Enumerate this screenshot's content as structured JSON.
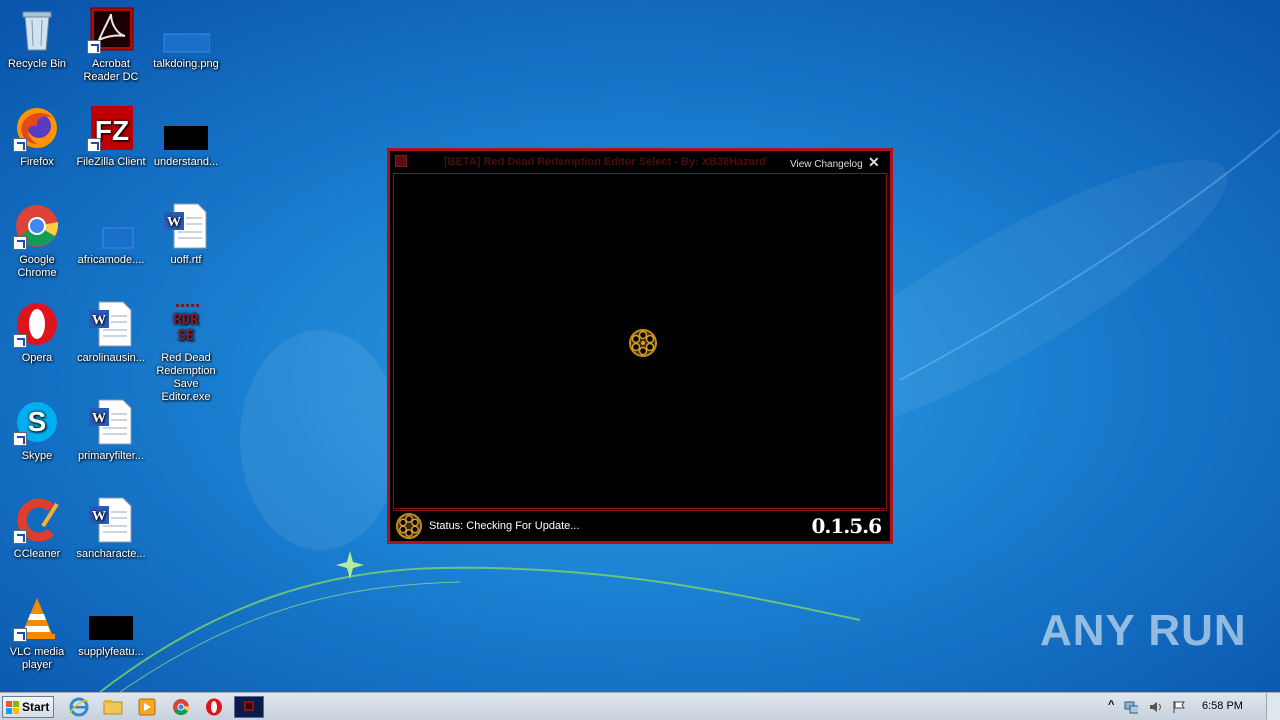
{
  "desktop": {
    "icons": [
      {
        "label": "Recycle Bin"
      },
      {
        "label": "Acrobat Reader DC"
      },
      {
        "label": "talkdoing.png"
      },
      {
        "label": "Firefox"
      },
      {
        "label": "FileZilla Client"
      },
      {
        "label": "understand..."
      },
      {
        "label": "Google Chrome"
      },
      {
        "label": "africamode...."
      },
      {
        "label": "uoff.rtf"
      },
      {
        "label": "Opera"
      },
      {
        "label": "carolinausin..."
      },
      {
        "label": "Red Dead Redemption Save Editor.exe"
      },
      {
        "label": "Skype"
      },
      {
        "label": "primaryfilter..."
      },
      {
        "label": "CCleaner"
      },
      {
        "label": "sancharacte..."
      },
      {
        "label": "VLC media player"
      },
      {
        "label": "supplyfeatu..."
      }
    ],
    "rdr_logo_text": "RDR SE"
  },
  "editor": {
    "title": "[BETA] Red Dead Redemption Editor Select - By: XB36Hazard",
    "changelog_label": "View Changelog",
    "close_label": "✕",
    "status_text": "Status: Checking For Update...",
    "version": "0.1.5.6",
    "accent_color": "#b0121d"
  },
  "taskbar": {
    "start_label": "Start",
    "clock": "6:58 PM",
    "tray_expand": "^"
  },
  "watermark": "ANY RUN"
}
